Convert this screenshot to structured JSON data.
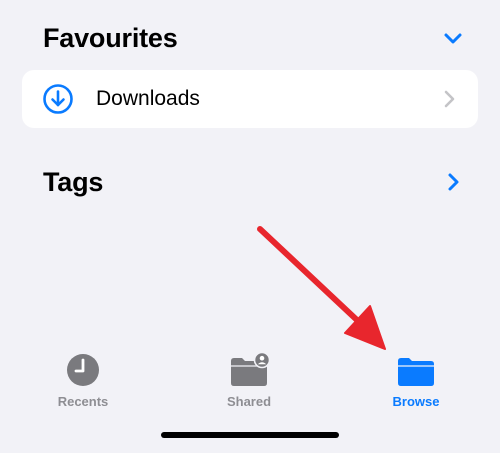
{
  "colors": {
    "background": "#f2f2f7",
    "card": "#ffffff",
    "accent": "#0a7bff",
    "inactive": "#8e8e93",
    "inactive_icon": "#7a7a7e",
    "disclosure": "#c4c4c7",
    "annotation_arrow": "#e8262d"
  },
  "favourites": {
    "title": "Favourites",
    "toggle_icon": "chevron-down-icon",
    "items": [
      {
        "label": "Downloads",
        "icon": "download-circle-icon",
        "accessory": "chevron-right-icon"
      }
    ]
  },
  "tags": {
    "title": "Tags",
    "toggle_icon": "chevron-right-icon"
  },
  "tabbar": {
    "selected": "Browse",
    "tabs": [
      {
        "label": "Recents",
        "icon": "clock-icon"
      },
      {
        "label": "Shared",
        "icon": "shared-folder-icon"
      },
      {
        "label": "Browse",
        "icon": "folder-icon"
      }
    ]
  }
}
